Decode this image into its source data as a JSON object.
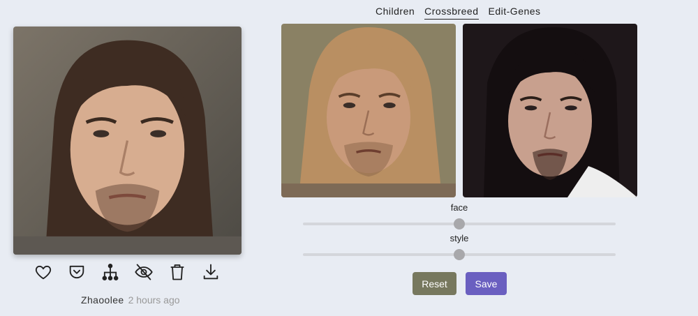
{
  "tabs": [
    {
      "label": "Children",
      "active": false
    },
    {
      "label": "Crossbreed",
      "active": true
    },
    {
      "label": "Edit-Genes",
      "active": false
    }
  ],
  "main_image": {
    "alt": "generated portrait"
  },
  "parents": [
    {
      "alt": "parent portrait A"
    },
    {
      "alt": "parent portrait B"
    }
  ],
  "actions": [
    "heart-icon",
    "pocket-icon",
    "family-tree-icon",
    "eye-off-icon",
    "trash-icon",
    "download-icon"
  ],
  "author": {
    "name": "Zhaoolee",
    "time": "2 hours ago"
  },
  "sliders": {
    "face": {
      "label": "face",
      "value": 0.5
    },
    "style": {
      "label": "style",
      "value": 0.5
    }
  },
  "buttons": {
    "reset": {
      "label": "Reset",
      "color": "#77785e"
    },
    "save": {
      "label": "Save",
      "color": "#6a5fc0"
    }
  }
}
